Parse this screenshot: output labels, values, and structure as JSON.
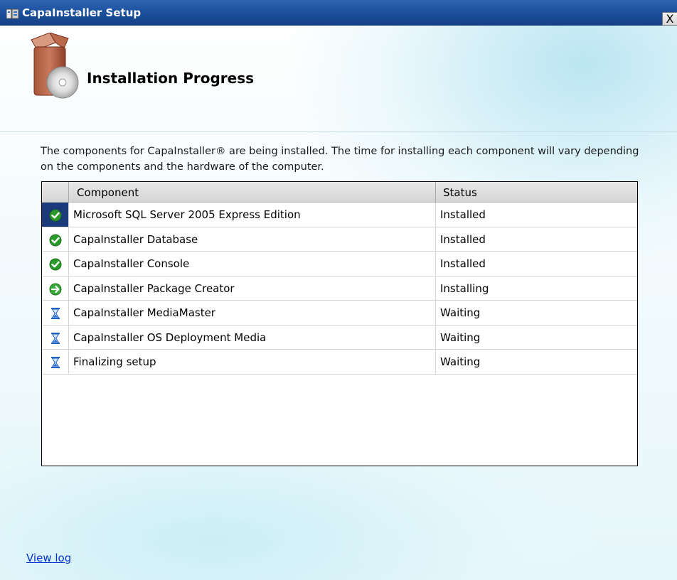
{
  "window": {
    "title": "CapaInstaller Setup",
    "close_label": "X"
  },
  "header": {
    "title": "Installation Progress"
  },
  "description": "The components for CapaInstaller® are being installed. The time for installing each component will vary depending on the components and the hardware of the computer.",
  "table": {
    "columns": [
      "",
      "Component",
      "Status"
    ],
    "rows": [
      {
        "icon": "check-icon",
        "component": "Microsoft SQL Server 2005 Express Edition",
        "status": "Installed",
        "selected": true
      },
      {
        "icon": "check-icon",
        "component": "CapaInstaller Database",
        "status": "Installed"
      },
      {
        "icon": "check-icon",
        "component": "CapaInstaller Console",
        "status": "Installed"
      },
      {
        "icon": "arrow-right-icon",
        "component": "CapaInstaller Package Creator",
        "status": "Installing"
      },
      {
        "icon": "hourglass-icon",
        "component": "CapaInstaller MediaMaster",
        "status": "Waiting"
      },
      {
        "icon": "hourglass-icon",
        "component": "CapaInstaller OS Deployment Media",
        "status": "Waiting"
      },
      {
        "icon": "hourglass-icon",
        "component": "Finalizing setup",
        "status": "Waiting"
      }
    ]
  },
  "footer": {
    "view_log_label": "View log"
  },
  "colors": {
    "titlebar": "#1a4f9c",
    "link": "#0033cc",
    "installed": "#2a9a2a",
    "installing": "#3aaa3a",
    "waiting": "#2060c0"
  }
}
